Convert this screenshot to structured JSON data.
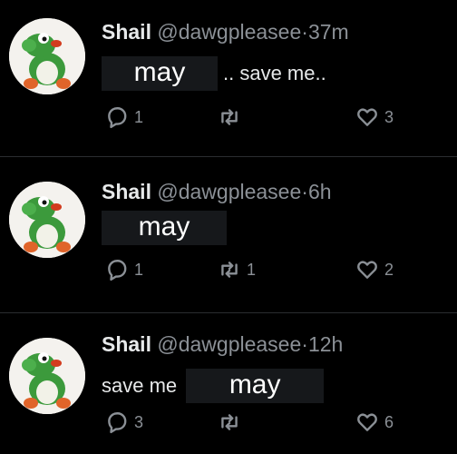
{
  "tweets": [
    {
      "name": "Shail",
      "handle": "@dawgpleasee",
      "dot": "·",
      "time": "37m",
      "redacted_text": "may",
      "text": ".. save me..",
      "replies": "1",
      "retweets": "",
      "likes": "3"
    },
    {
      "name": "Shail",
      "handle": "@dawgpleasee",
      "dot": "·",
      "time": "6h",
      "redacted_text": "may",
      "text": "",
      "replies": "1",
      "retweets": "1",
      "likes": "2"
    },
    {
      "name": "Shail",
      "handle": "@dawgpleasee",
      "dot": "·",
      "time": "12h",
      "redacted_text": "may",
      "text": "save me",
      "replies": "3",
      "retweets": "",
      "likes": "6"
    }
  ],
  "icons": {
    "avatar": "yoshi-sitting-avatar",
    "reply": "reply-icon",
    "retweet": "retweet-icon",
    "like": "heart-icon"
  }
}
